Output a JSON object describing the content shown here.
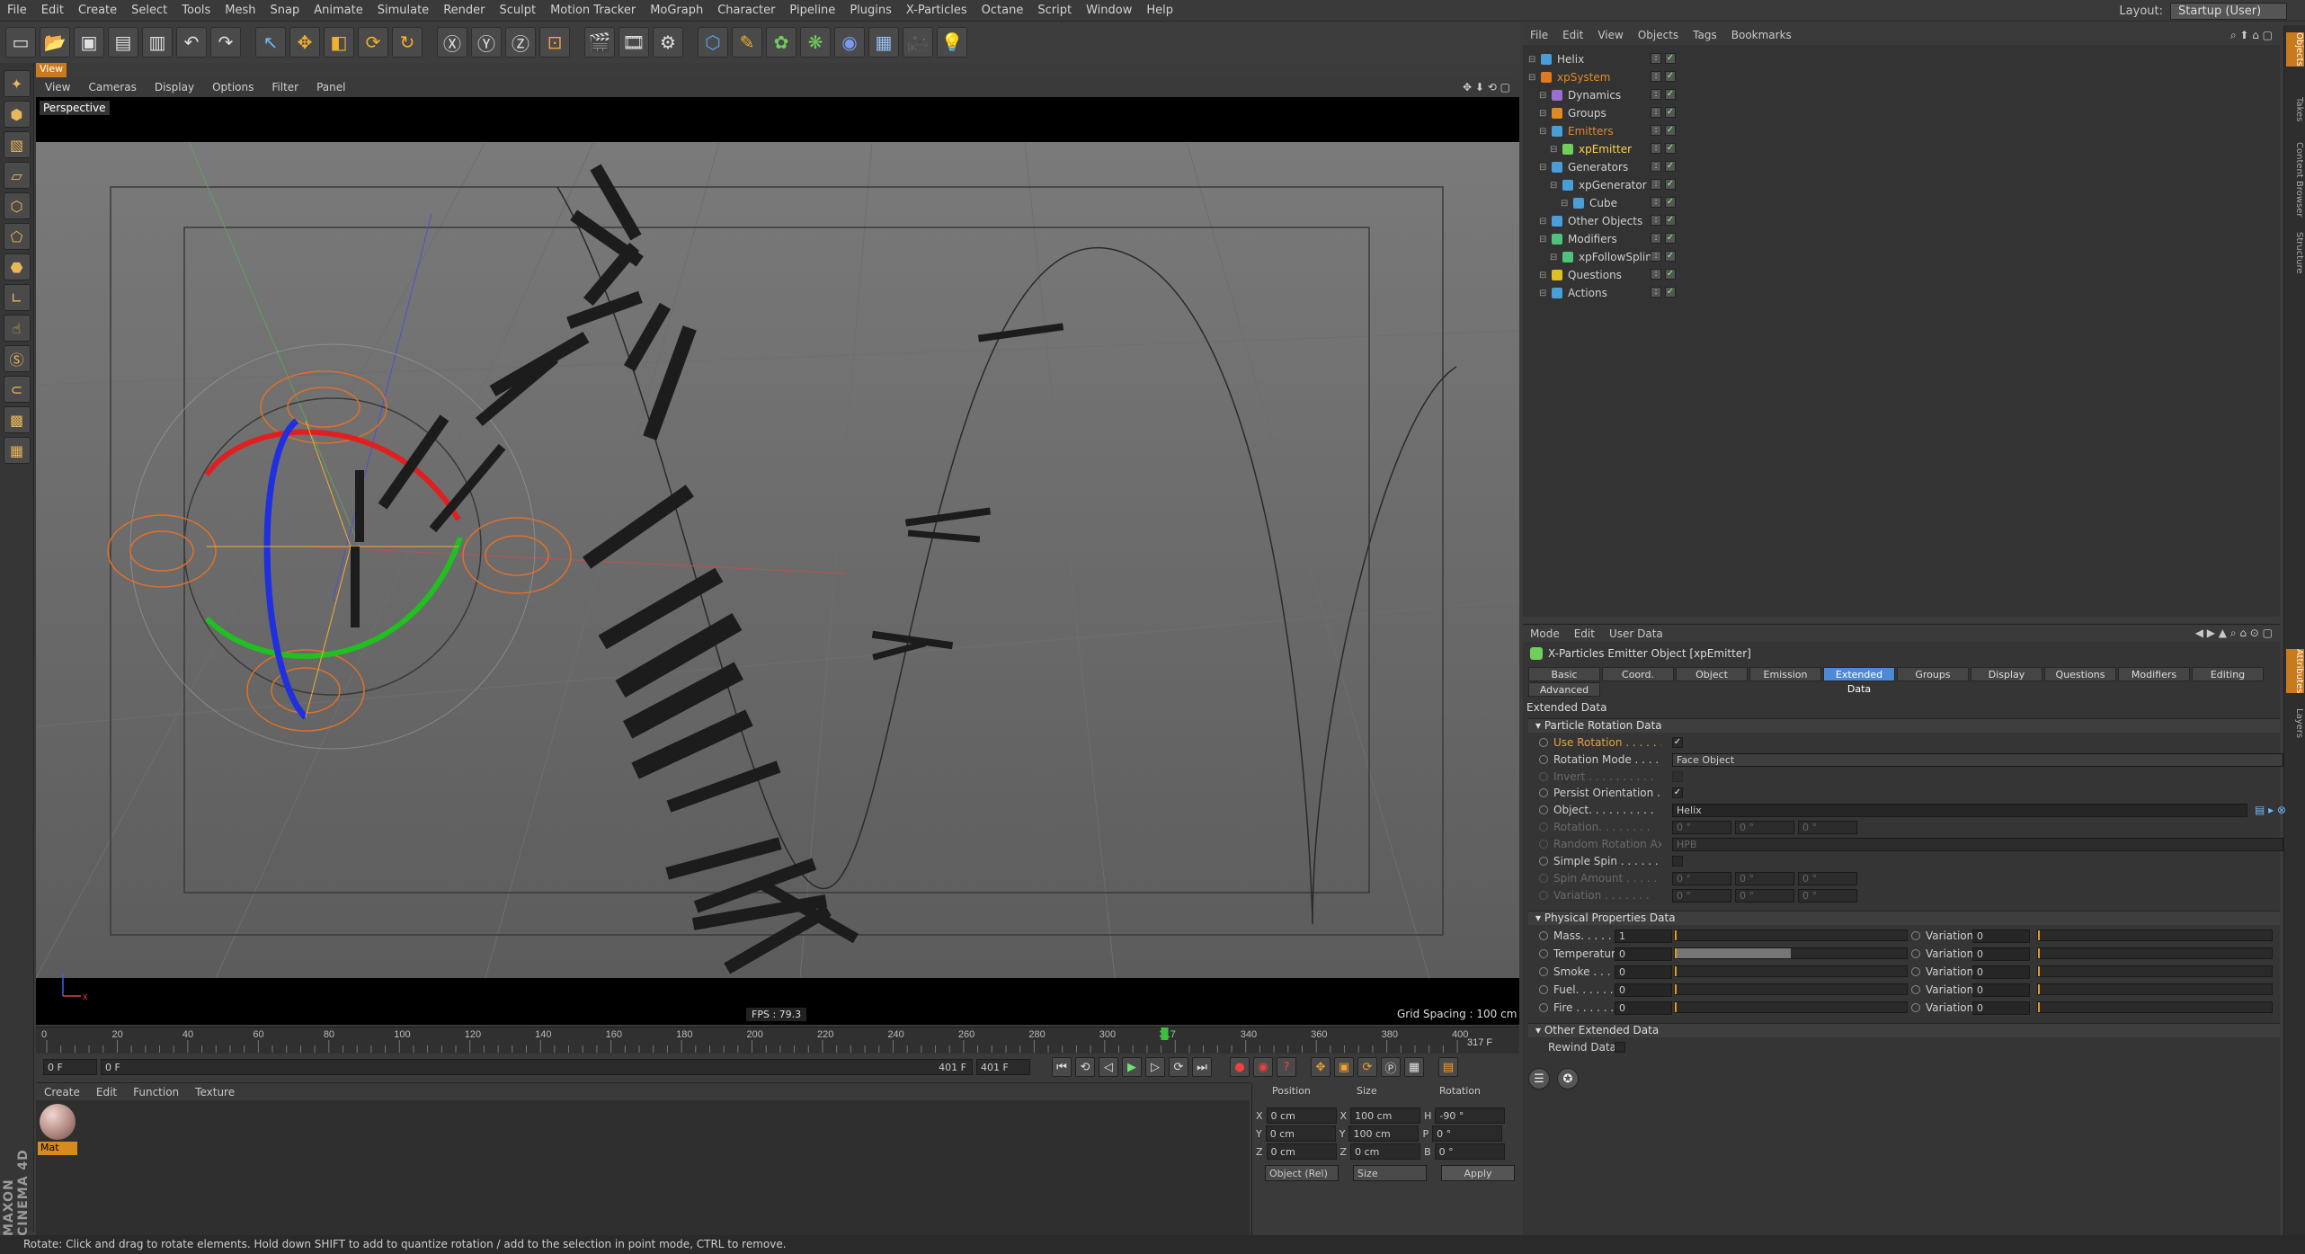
{
  "menubar": {
    "items": [
      "File",
      "Edit",
      "Create",
      "Select",
      "Tools",
      "Mesh",
      "Snap",
      "Animate",
      "Simulate",
      "Render",
      "Sculpt",
      "Motion Tracker",
      "MoGraph",
      "Character",
      "Pipeline",
      "Plugins",
      "X-Particles",
      "Octane",
      "Script",
      "Window",
      "Help"
    ],
    "layout_label": "Layout:",
    "layout_value": "Startup (User)"
  },
  "viewport": {
    "tab": "View",
    "menu": [
      "View",
      "Cameras",
      "Display",
      "Options",
      "Filter",
      "Panel"
    ],
    "camera_label": "Perspective",
    "fps": "FPS : 79.3",
    "grid_spacing": "Grid Spacing : 100 cm"
  },
  "timeline": {
    "ticks": [
      "0",
      "20",
      "40",
      "60",
      "80",
      "100",
      "120",
      "140",
      "160",
      "180",
      "200",
      "220",
      "240",
      "260",
      "280",
      "300",
      "317",
      "340",
      "360",
      "380",
      "400"
    ],
    "current_frame_label": "317 F",
    "start": "0 F",
    "preview_start": "0 F",
    "preview_end": "401 F",
    "end": "401 F"
  },
  "material": {
    "menu": [
      "Create",
      "Edit",
      "Function",
      "Texture"
    ],
    "name": "Mat"
  },
  "coords": {
    "headers": [
      "Position",
      "Size",
      "Rotation"
    ],
    "rows": [
      {
        "axis": "X",
        "pos": "0 cm",
        "size_axis": "X",
        "size": "100 cm",
        "rot_axis": "H",
        "rot": "-90 °"
      },
      {
        "axis": "Y",
        "pos": "0 cm",
        "size_axis": "Y",
        "size": "100 cm",
        "rot_axis": "P",
        "rot": "0 °"
      },
      {
        "axis": "Z",
        "pos": "0 cm",
        "size_axis": "Z",
        "size": "0 cm",
        "rot_axis": "B",
        "rot": "0 °"
      }
    ],
    "mode": "Object (Rel)",
    "size_mode": "Size",
    "apply": "Apply"
  },
  "status": "Rotate: Click and drag to rotate elements. Hold down SHIFT to add to quantize rotation / add to the selection in point mode, CTRL to remove.",
  "brand": "MAXON CINEMA 4D",
  "object_manager": {
    "menu": [
      "File",
      "Edit",
      "View",
      "Objects",
      "Tags",
      "Bookmarks"
    ],
    "objects": [
      {
        "name": "Helix",
        "indent": 0,
        "color": "#4a9ed8",
        "selected": false
      },
      {
        "name": "xpSystem",
        "indent": 0,
        "color": "#e07a22",
        "selected": true
      },
      {
        "name": "Dynamics",
        "indent": 1,
        "color": "#9a6fd0",
        "selected": false
      },
      {
        "name": "Groups",
        "indent": 1,
        "color": "#e08a22",
        "selected": false
      },
      {
        "name": "Emitters",
        "indent": 1,
        "color": "#4a9ed8",
        "selected": true
      },
      {
        "name": "xpEmitter",
        "indent": 2,
        "color": "#6fcf5a",
        "selected": true,
        "active": true
      },
      {
        "name": "Generators",
        "indent": 1,
        "color": "#4a9ed8",
        "selected": false
      },
      {
        "name": "xpGenerator",
        "indent": 2,
        "color": "#4a9ed8",
        "selected": false
      },
      {
        "name": "Cube",
        "indent": 3,
        "color": "#4a9ed8",
        "selected": false
      },
      {
        "name": "Other Objects",
        "indent": 1,
        "color": "#4a9ed8",
        "selected": false
      },
      {
        "name": "Modifiers",
        "indent": 1,
        "color": "#4ec27a",
        "selected": false
      },
      {
        "name": "xpFollowSpline",
        "indent": 2,
        "color": "#4ec27a",
        "selected": false
      },
      {
        "name": "Questions",
        "indent": 1,
        "color": "#e0c020",
        "selected": false
      },
      {
        "name": "Actions",
        "indent": 1,
        "color": "#4a9ed8",
        "selected": false
      }
    ]
  },
  "attribute_manager": {
    "menu": [
      "Mode",
      "Edit",
      "User Data"
    ],
    "title": "X-Particles Emitter Object [xpEmitter]",
    "tabs": [
      "Basic",
      "Coord.",
      "Object",
      "Emission",
      "Extended Data",
      "Groups",
      "Display",
      "Questions",
      "Modifiers",
      "Editing",
      "Advanced"
    ],
    "active_tab": "Extended Data",
    "heading": "Extended Data",
    "sec_rotation": "Particle Rotation Data",
    "use_rotation": "Use Rotation . . . . . .",
    "rotation_mode": "Rotation Mode . . . . .",
    "rotation_mode_value": "Face Object",
    "invert": "Invert . . . . . . . . . .",
    "persist": "Persist Orientation . .",
    "object": "Object. . . . . . . . . .",
    "object_value": "Helix",
    "rotation": "Rotation. . . . . . . .",
    "random_axis": "Random Rotation Axis",
    "random_axis_value": "HPB",
    "simple_spin": "Simple Spin . . . . . .",
    "spin_amount": "Spin Amount . . . . .",
    "variation": "Variation . . . . . . .",
    "zero_deg": "0 °",
    "sec_physical": "Physical Properties Data",
    "phys": [
      {
        "label": "Mass. . . . . . . . .",
        "value": "1",
        "fill": 0.0,
        "var": "0"
      },
      {
        "label": "Temperature",
        "value": "0",
        "fill": 0.5,
        "var": "0"
      },
      {
        "label": "Smoke . . . . . . . .",
        "value": "0",
        "fill": 0.0,
        "var": "0"
      },
      {
        "label": "Fuel. . . . . . . . .",
        "value": "0",
        "fill": 0.0,
        "var": "0"
      },
      {
        "label": "Fire . . . . . . . . .",
        "value": "0",
        "fill": 0.0,
        "var": "0"
      }
    ],
    "variation_label": "Variation",
    "sec_other": "Other Extended Data",
    "rewind": "Rewind Data"
  },
  "right_tabs": [
    "Objects",
    "Takes",
    "Content Browser",
    "Structure",
    "Attributes",
    "Layers"
  ]
}
